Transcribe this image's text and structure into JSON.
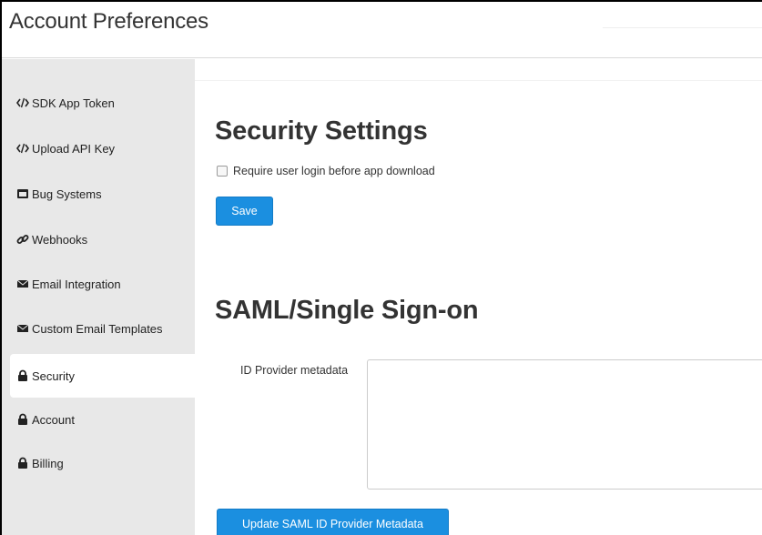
{
  "header": {
    "title": "Account Preferences"
  },
  "sidebar": {
    "items": [
      {
        "label": "SDK App Token",
        "icon": "code-icon"
      },
      {
        "label": "Upload API Key",
        "icon": "code-icon"
      },
      {
        "label": "Bug Systems",
        "icon": "window-icon"
      },
      {
        "label": "Webhooks",
        "icon": "link-icon"
      },
      {
        "label": "Email Integration",
        "icon": "envelope-icon"
      },
      {
        "label": "Custom Email Templates",
        "icon": "envelope-icon"
      },
      {
        "label": "Security",
        "icon": "lock-icon",
        "active": true
      },
      {
        "label": "Account",
        "icon": "lock-icon"
      },
      {
        "label": "Billing",
        "icon": "lock-icon"
      }
    ]
  },
  "security": {
    "heading": "Security Settings",
    "require_login_label": "Require user login before app download",
    "require_login_checked": false,
    "save_label": "Save"
  },
  "saml": {
    "heading": "SAML/Single Sign-on",
    "metadata_label": "ID Provider metadata",
    "metadata_value": "",
    "update_label": "Update SAML ID Provider Metadata"
  },
  "colors": {
    "primary_button": "#1b8fe0",
    "sidebar_bg": "#e8e8e8",
    "text": "#333333"
  }
}
